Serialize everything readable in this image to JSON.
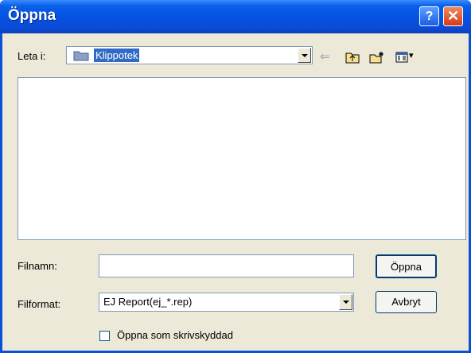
{
  "dialog": {
    "title": "Öppna",
    "help_label": "?",
    "close_label": "✕"
  },
  "look_in": {
    "label": "Leta i:",
    "value": "Klippotek"
  },
  "toolbar": {
    "back_glyph": "⇐",
    "views_glyph": "▾"
  },
  "file_name": {
    "label": "Filnamn:",
    "value": ""
  },
  "file_type": {
    "label": "Filformat:",
    "value": "EJ Report(ej_*.rep)"
  },
  "buttons": {
    "open": "Öppna",
    "cancel": "Avbryt"
  },
  "read_only": {
    "label": "Öppna som skrivskyddad",
    "checked": false
  },
  "colors": {
    "title_bar": "#0553e3",
    "face": "#ece9d8",
    "selection": "#316ac5"
  }
}
